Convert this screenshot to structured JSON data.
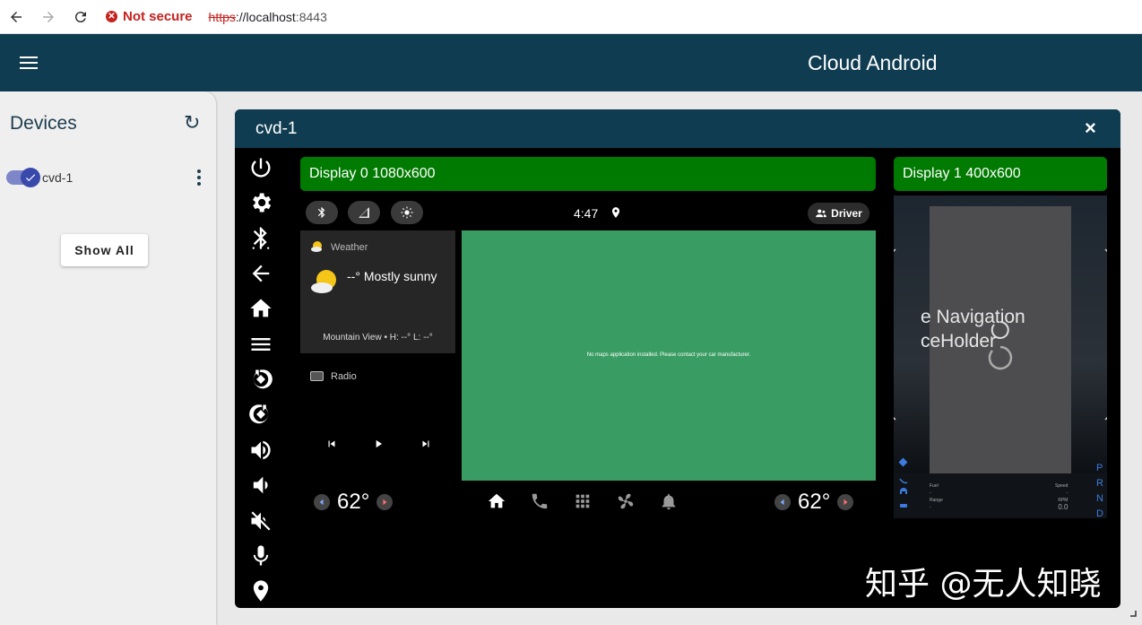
{
  "browser": {
    "security_label": "Not secure",
    "url_scheme": "https",
    "url_rest": "://localhost",
    "url_port": ":8443"
  },
  "app": {
    "title": "Cloud Android"
  },
  "sidebar": {
    "title": "Devices",
    "refresh_glyph": "↻",
    "devices": [
      {
        "name": "cvd-1",
        "enabled": true
      }
    ],
    "show_all_label": "Show All"
  },
  "panel": {
    "title": "cvd-1",
    "close_glyph": "×",
    "display0": {
      "label": "Display 0 1080x600",
      "clock": "4:47",
      "profile_label": "Driver",
      "weather": {
        "title": "Weather",
        "summary": "--° Mostly sunny",
        "location": "Mountain View • H: --° L: --°"
      },
      "radio_label": "Radio",
      "map_message": "No maps application installed. Please contact your car manufacturer.",
      "temp_left": "62°",
      "temp_right": "62°"
    },
    "display1": {
      "label": "Display 1 400x600",
      "nav_line1": "e Navigation",
      "nav_line2": "ceHolder",
      "gears": "P R N D",
      "cluster_fuel": "Fuel",
      "cluster_range": "Range",
      "cluster_speed": "Speed",
      "cluster_rpm": "RPM",
      "cluster_speed_value": "0.0"
    }
  },
  "watermark": "知乎 @无人知晓",
  "colors": {
    "app_bar": "#0f3c51",
    "display_label": "#007a00",
    "map": "#399c63",
    "accent": "#3949ab"
  }
}
